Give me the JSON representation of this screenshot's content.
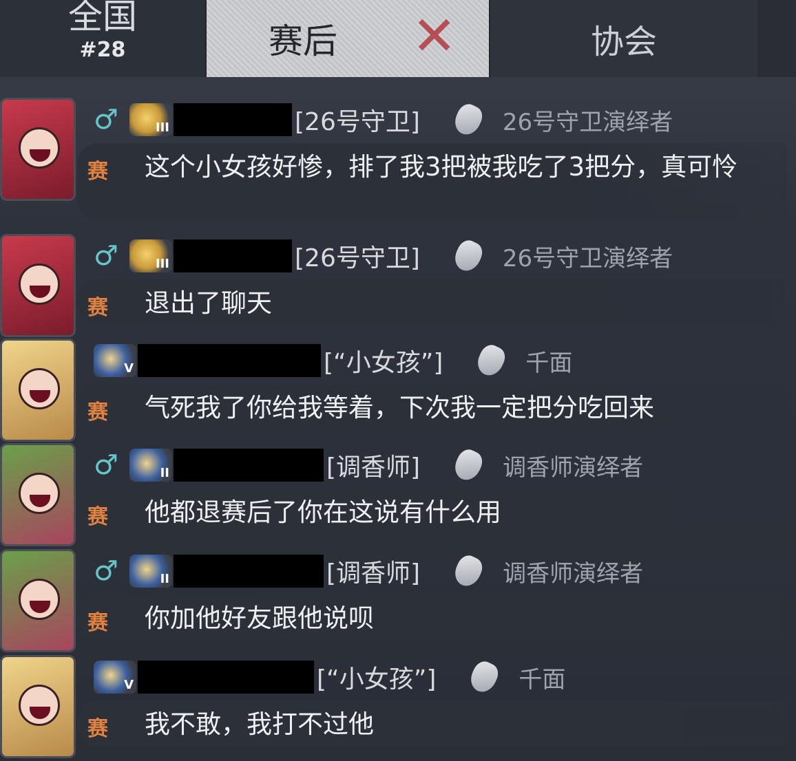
{
  "tabs": {
    "national": {
      "label": "全国",
      "rank": "#28"
    },
    "post_game": {
      "label": "赛后",
      "close": "✕"
    },
    "association": {
      "label": "协会"
    }
  },
  "colors": {
    "accent_gender": "#64c6c8",
    "game_icon": "#e0813f",
    "close_red": "#b23a3f"
  },
  "messages": [
    {
      "gender": "♂",
      "tier": "III",
      "role": "[26号守卫]",
      "title": "26号守卫演绎者",
      "game_tag": "赛",
      "text": "这个小女孩好惨，排了我3把被我吃了3把分，真可怜"
    },
    {
      "gender": "♂",
      "tier": "III",
      "role": "[26号守卫]",
      "title": "26号守卫演绎者",
      "game_tag": "赛",
      "text": "退出了聊天"
    },
    {
      "gender": "",
      "tier": "V",
      "role": "[“小女孩”]",
      "title": "千面",
      "game_tag": "赛",
      "text": "气死我了你给我等着，下次我一定把分吃回来"
    },
    {
      "gender": "♂",
      "tier": "II",
      "role": "[调香师]",
      "title": "调香师演绎者",
      "game_tag": "赛",
      "text": "他都退赛后了你在这说有什么用"
    },
    {
      "gender": "♂",
      "tier": "II",
      "role": "[调香师]",
      "title": "调香师演绎者",
      "game_tag": "赛",
      "text": "你加他好友跟他说呗"
    },
    {
      "gender": "",
      "tier": "V",
      "role": "[“小女孩”]",
      "title": "千面",
      "game_tag": "赛",
      "text": "我不敢，我打不过他"
    }
  ]
}
